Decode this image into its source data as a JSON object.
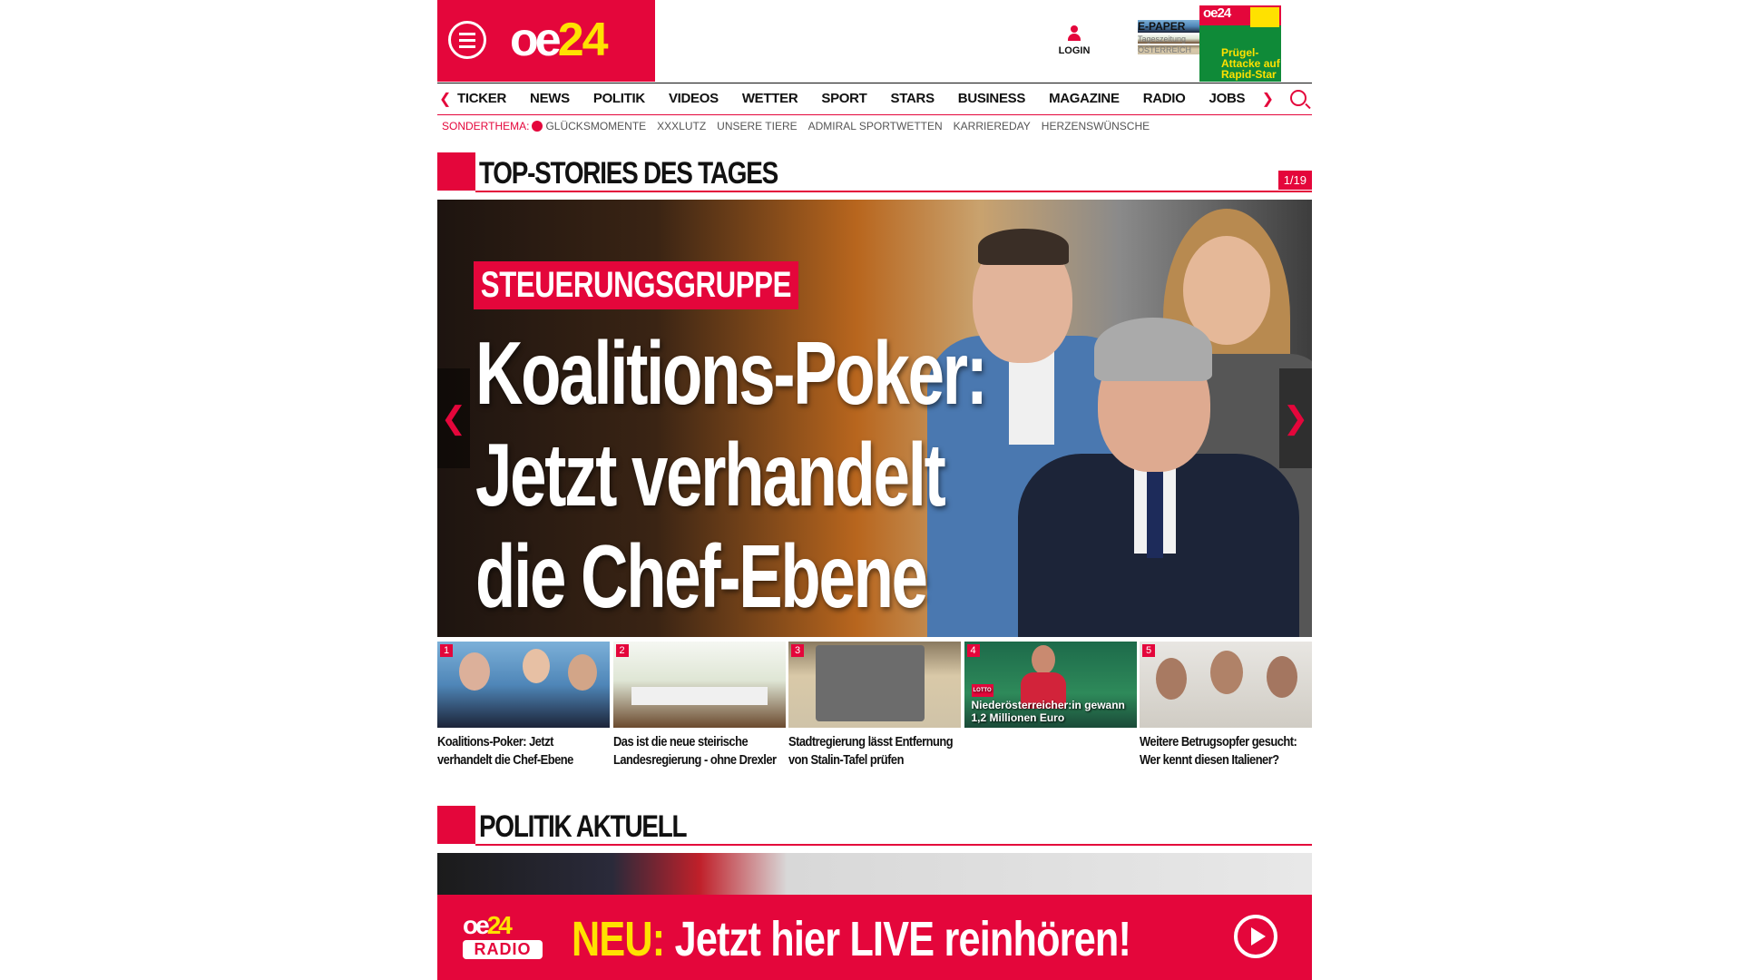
{
  "header": {
    "logo_text": "oe",
    "logo_num": "24",
    "login_label": "LOGIN",
    "epaper": {
      "title": "E-PAPER",
      "line1": "Tageszeitung",
      "line2": "ÖSTERREICH",
      "cover_logo": "oe24",
      "cover_headline": "Prügel-Attacke auf Rapid-Star"
    }
  },
  "nav": {
    "items": [
      "TICKER",
      "NEWS",
      "POLITIK",
      "VIDEOS",
      "WETTER",
      "SPORT",
      "STARS",
      "BUSINESS",
      "MAGAZINE",
      "RADIO",
      "JOBS"
    ],
    "prev_arrow": "❮",
    "next_arrow": "❯"
  },
  "subnav": {
    "label": "SONDERTHEMA:",
    "items": [
      "GLÜCKSMOMENTE",
      "XXXLUTZ",
      "UNSERE TIERE",
      "ADMIRAL SPORTWETTEN",
      "KARRIEREDAY",
      "HERZENSWÜNSCHE"
    ]
  },
  "top_stories": {
    "title": "TOP-STORIES DES TAGES",
    "counter": "1/19",
    "hero": {
      "kicker": "STEUERUNGSGRUPPE",
      "headline_lines": [
        "Koalitions-Poker:",
        "Jetzt verhandelt",
        "die Chef-Ebene"
      ],
      "prev": "❮",
      "next": "❯"
    },
    "teasers": [
      {
        "num": "1",
        "caption": "Koalitions-Poker: Jetzt verhandelt die Chef-Ebene"
      },
      {
        "num": "2",
        "caption": "Das ist die neue steirische Landesregierung - ohne Drexler"
      },
      {
        "num": "3",
        "caption": "Stadtregierung lässt Entfernung von Stalin-Tafel prüfen"
      },
      {
        "num": "4",
        "caption": "",
        "overlay_tag": "LOTTO",
        "overlay": "Niederösterreicher:in gewann 1,2 Millionen Euro"
      },
      {
        "num": "5",
        "caption": "Weitere Betrugsopfer gesucht: Wer kennt diesen Italiener?"
      }
    ]
  },
  "politik": {
    "title": "POLITIK AKTUELL"
  },
  "radio_banner": {
    "logo_top": "oe",
    "logo_num": "24",
    "logo_bottom": "RADIO",
    "neu": "NEU:",
    "message": " Jetzt hier LIVE reinhören!"
  },
  "colors": {
    "brand_red": "#e4063b",
    "accent_yellow": "#ffe100"
  },
  "icons": [
    "hamburger-menu-icon",
    "user-icon",
    "search-icon",
    "play-icon"
  ]
}
